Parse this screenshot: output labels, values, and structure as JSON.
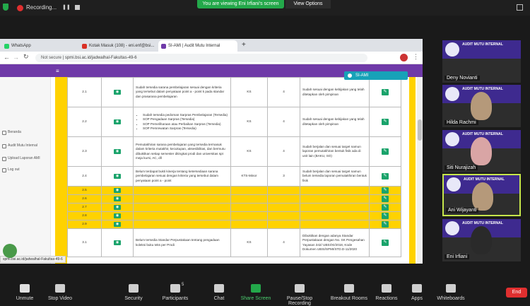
{
  "zoom": {
    "recording_label": "Recording...",
    "viewing_banner": "You are viewing Eni Irfiani's screen",
    "view_options": "View Options"
  },
  "browser": {
    "tabs": [
      {
        "label": "WhatsApp",
        "color": "#25d366"
      },
      {
        "label": "Kotak Masuk (108) - eni.enf@bsi...",
        "color": "#d93025"
      },
      {
        "label": "SI-AMI | Audit Mutu Internal",
        "color": "#6f3aa8"
      }
    ],
    "url_prefix": "Not secure",
    "url": "spmi.bsi.ac.id/jadwalhal-Fakultas-49-6",
    "status_url": "spmi.bsi.ac.id/jadwalhal-Fakultas-49-6"
  },
  "sidebar": {
    "items": [
      "Beranda",
      "Audit Mutu Internal",
      "Upload Laporan AMI",
      "Log out"
    ]
  },
  "notification": "SI-AMI",
  "table": {
    "rows": [
      {
        "no": "2.1",
        "desc": "Sudah tersedia sarana pembelajaran sesuai dengan kriteria yang tersebut dalam penyataan point a - point k pada standar dan prasarana pembelajaran",
        "cat": "KS",
        "score": "4",
        "note": "Sudah sesuai dengan kebijakan yang telah ditetapkan oleh pimpinan"
      },
      {
        "no": "2.2",
        "desc_list": [
          "Sudah tersedia pedoman Sarpras Pembelajaran (Tersedia)",
          "SOP Pengadaan Sarpras (Tersedia)",
          "SOP Pemeliharaan atau Perbaikan Sarpras (Tersedia)",
          "SOP Pemrewatan Sarpras (Tersedia)"
        ],
        "cat": "KS",
        "score": "4",
        "note": "Sudah sesuai dengan kebijakan yang telah ditetapkan oleh pimpinan"
      },
      {
        "no": "2.3",
        "desc": "Pemutakhiran sarana pembelajaran yang tersedia termasuk dalam kriteria mutakhir, kecukupan, aksesibilitas, dan bermutu dibuktikan setiap semester ditingkat prodi dan universitas spt meja kursi, AC, dll",
        "cat": "KS",
        "score": "4",
        "note": "Sudah berjalan dan sesuai target namun laporan pemutakhiran bentuk fisik ada di unit lain (BAKU, SO)"
      },
      {
        "no": "2.4",
        "desc": "Belum terdapat bukti kinerja tentang ketersediaan sarana pembelajaran sesuai dengan kriteria yang tersebut dalam penyataan point a - point",
        "cat": "KTS-Minor",
        "score": "3",
        "note": "Sudah berjalan dan sesuai target namun belum tersedia laporan pemutakhiran bentuk fisik"
      },
      {
        "no": "2.5",
        "yellow": true
      },
      {
        "no": "2.6",
        "yellow": true
      },
      {
        "no": "2.7",
        "yellow": true
      },
      {
        "no": "2.8",
        "yellow": true
      },
      {
        "no": "2.9",
        "yellow": true
      },
      {
        "no": "3.1",
        "desc": "Belum tersedia Standar Perpustakaan tentang pengadaan koleksi buku teks per Prodi",
        "cat": "KS",
        "score": "4",
        "note": "Dibuktikan dengan adanya Standar Perpustakaan dengan No. SK Pengesahan Yayasan 342/ UBSI/XI/2018, Kode Dokumen UBSI/SPMI/STD.D-11/2020"
      }
    ]
  },
  "participants": [
    {
      "name": "Deny Novianti",
      "speaking": false
    },
    {
      "name": "Hilda Rachmi",
      "speaking": false
    },
    {
      "name": "Siti Nurajizah",
      "speaking": false
    },
    {
      "name": "Ani Wijayanti",
      "speaking": true
    },
    {
      "name": "Eni Irfiani",
      "speaking": false
    }
  ],
  "tile_banner": "AUDIT MUTU INTERNAL",
  "toolbar": {
    "items": [
      "Unmute",
      "Stop Video",
      "Security",
      "Participants",
      "Chat",
      "Share Screen",
      "Pause/Stop Recording",
      "Breakout Rooms",
      "Reactions",
      "Apps",
      "Whiteboards"
    ],
    "participants_count": "5",
    "end_label": "End"
  }
}
